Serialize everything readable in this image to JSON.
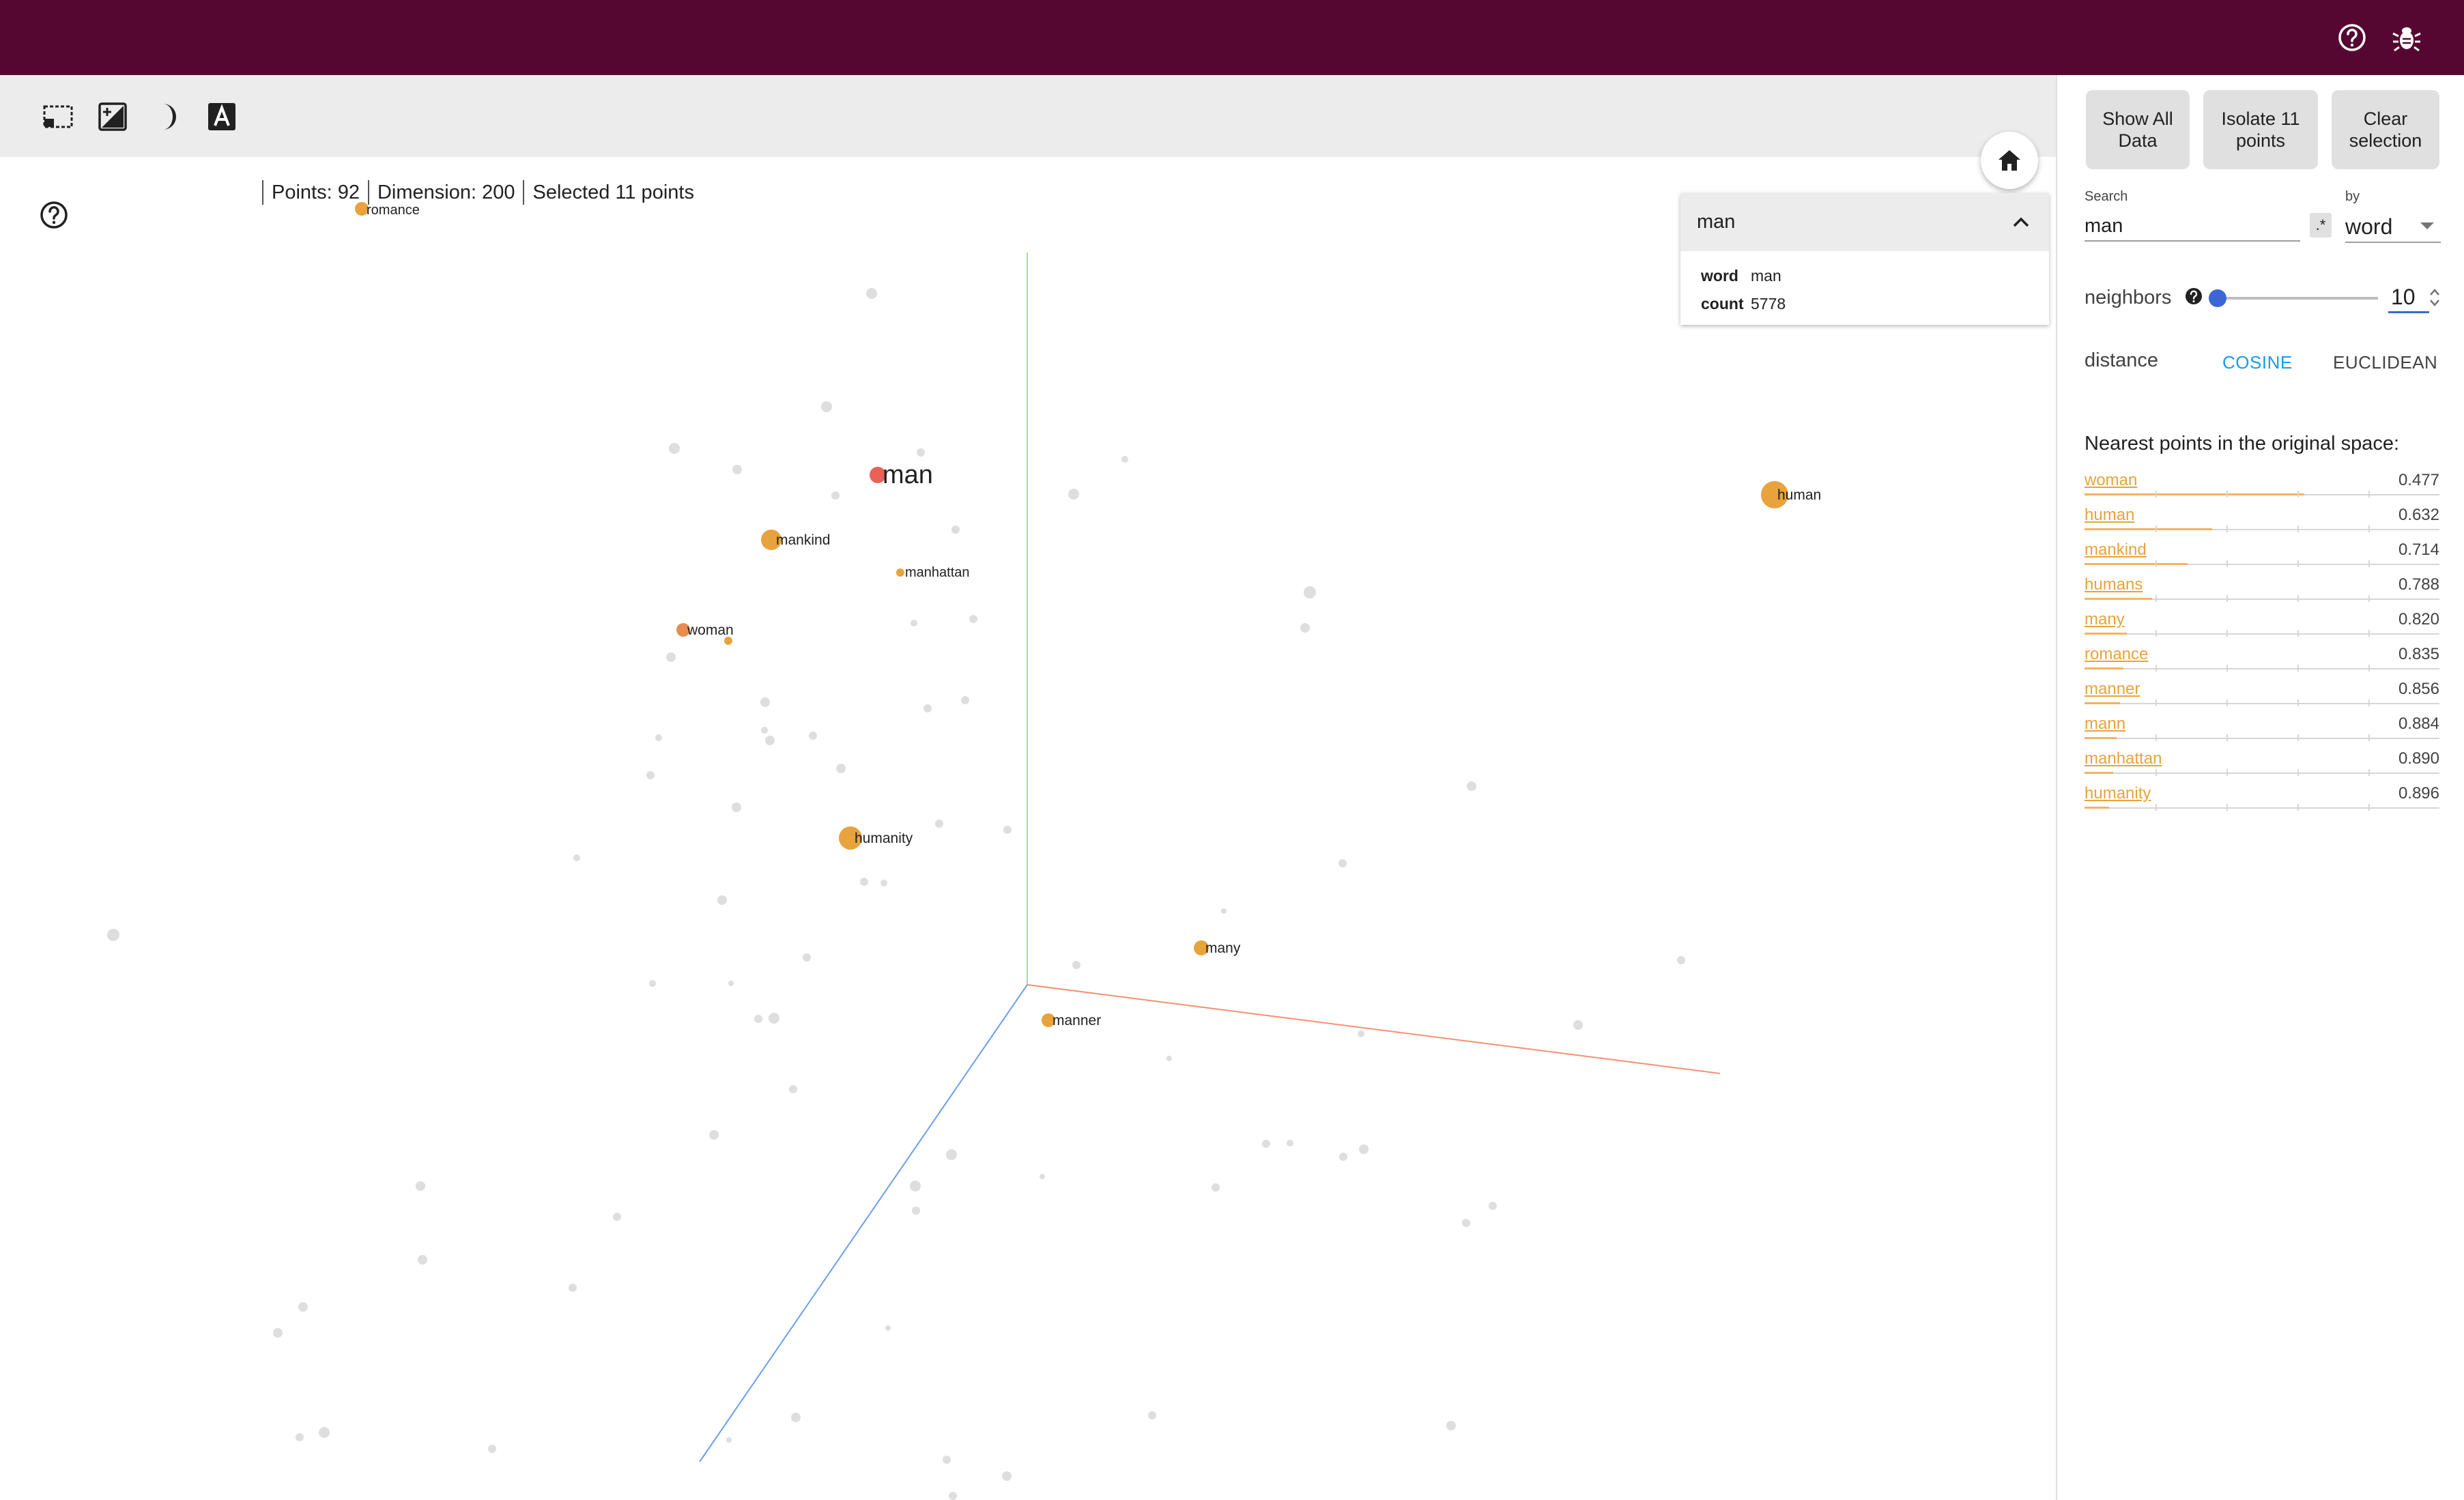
{
  "colors": {
    "header_bg": "#560731",
    "toolbar_bg": "#ececec",
    "selected_point": "#e8a33c",
    "focus_point": "#e8615a",
    "nearest_point": "#e88b4d",
    "unselected_point": "#dedede",
    "accent_blue": "#3c65d6",
    "cosine_active": "#1a9be8"
  },
  "header": {
    "icons": [
      "help-icon",
      "bug-icon"
    ]
  },
  "toolbar": {
    "points_label": "Points: 92",
    "dimension_label": "Dimension: 200",
    "selected_label": "Selected 11 points",
    "icons": [
      "select-box-icon",
      "night-mode-edit-icon",
      "night-mode-icon",
      "label-toggle-icon"
    ]
  },
  "inspector_card": {
    "title": "man",
    "fields": [
      {
        "key": "word",
        "value": "man"
      },
      {
        "key": "count",
        "value": "5778"
      }
    ]
  },
  "right_panel": {
    "buttons": {
      "show_all": "Show All\nData",
      "isolate": "Isolate 11\npoints",
      "clear": "Clear\nselection"
    },
    "search_label": "Search",
    "search_value": "man",
    "regex_toggle": ".*",
    "by_label": "by",
    "by_value": "word",
    "neighbors_label": "neighbors",
    "neighbors_value": "10",
    "neighbors_slider_fraction": 0.02,
    "distance_label": "distance",
    "distance_cosine": "COSINE",
    "distance_euclidean": "EUCLIDEAN",
    "distance_selected": "COSINE",
    "nearest_title": "Nearest points in the original space:",
    "nearest": [
      {
        "word": "woman",
        "distance": "0.477",
        "fraction": 0.62
      },
      {
        "word": "human",
        "distance": "0.632",
        "fraction": 0.36
      },
      {
        "word": "mankind",
        "distance": "0.714",
        "fraction": 0.29
      },
      {
        "word": "humans",
        "distance": "0.788",
        "fraction": 0.19
      },
      {
        "word": "many",
        "distance": "0.820",
        "fraction": 0.12
      },
      {
        "word": "romance",
        "distance": "0.835",
        "fraction": 0.11
      },
      {
        "word": "manner",
        "distance": "0.856",
        "fraction": 0.1
      },
      {
        "word": "mann",
        "distance": "0.884",
        "fraction": 0.09
      },
      {
        "word": "manhattan",
        "distance": "0.890",
        "fraction": 0.08
      },
      {
        "word": "humanity",
        "distance": "0.896",
        "fraction": 0.07
      }
    ]
  },
  "projection": {
    "labels": [
      "man",
      "human",
      "mankind",
      "manhattan",
      "woman",
      "humanity",
      "many",
      "manner",
      "romance"
    ]
  }
}
